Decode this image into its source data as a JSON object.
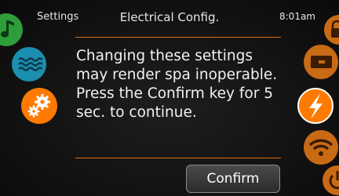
{
  "header": {
    "left_label": "Settings",
    "title": "Electrical Config.",
    "time": "8:01am"
  },
  "message": "Changing these settings\nmay render spa inoperable.\nPress the Confirm key for 5\nsec. to continue.",
  "confirm_label": "Confirm",
  "colors": {
    "accent": "#ff7a00",
    "divider": "#d9701c",
    "teal": "#1b8fb0",
    "green": "#2e9e3a"
  },
  "left_icons": [
    "music-icon",
    "water-icon",
    "gears-icon"
  ],
  "right_icons": [
    "lock-icon",
    "device-icon",
    "lightning-icon",
    "wifi-icon",
    "power-icon"
  ]
}
